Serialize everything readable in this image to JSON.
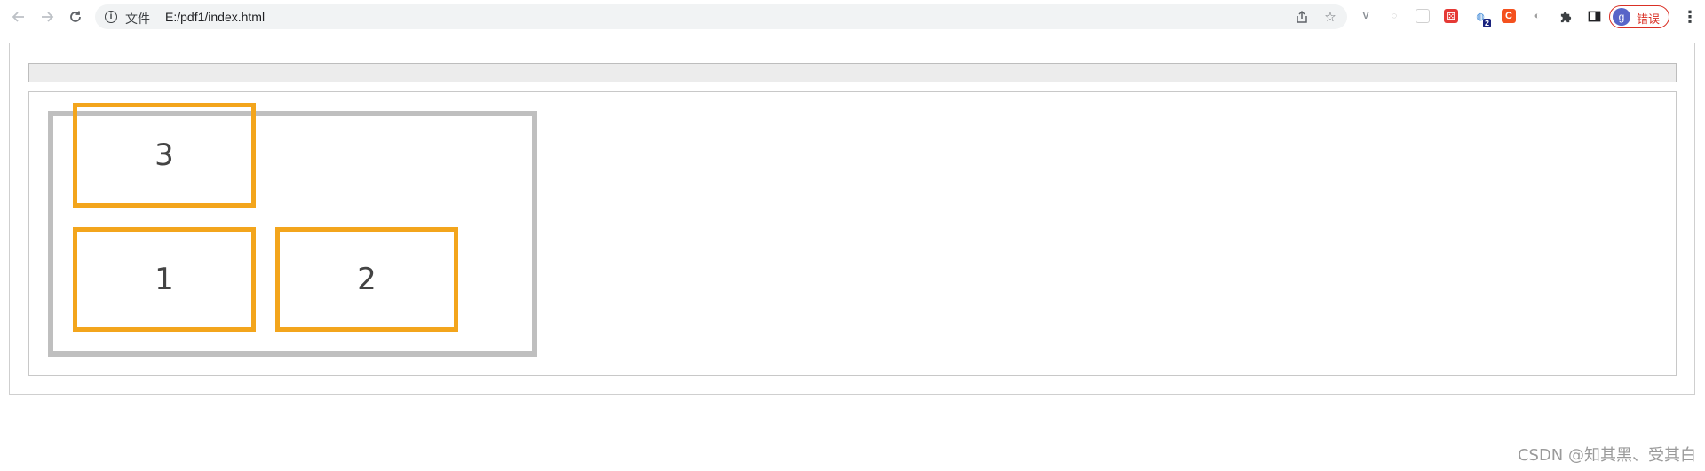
{
  "browser": {
    "scheme_label": "文件",
    "url": "E:/pdf1/index.html",
    "profile": {
      "initial": "g",
      "label": "错误"
    },
    "extensions": [
      {
        "name": "v-icon",
        "glyph": "V"
      },
      {
        "name": "puzzle-ext-1-icon",
        "glyph": "◌"
      },
      {
        "name": "blank-ext-icon",
        "glyph": "▭"
      },
      {
        "name": "dice-ext-icon",
        "glyph": "⚄"
      },
      {
        "name": "globe-ext-icon",
        "glyph": "◍",
        "badge": "2"
      },
      {
        "name": "c-ext-icon",
        "glyph": "C"
      },
      {
        "name": "circle-ext-icon",
        "glyph": "◐"
      }
    ],
    "accent_color": "#d93025"
  },
  "page": {
    "items": [
      {
        "label": "3"
      },
      {
        "label": "1"
      },
      {
        "label": "2"
      }
    ],
    "item_border_color": "#f3a51c",
    "container_border_color": "#bfbfbf"
  },
  "watermark": "CSDN @知其黑、受其白"
}
